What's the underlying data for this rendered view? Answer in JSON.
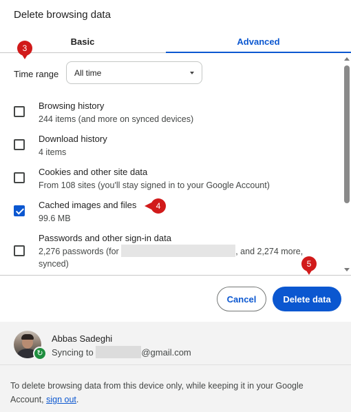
{
  "dialog": {
    "title": "Delete browsing data"
  },
  "tabs": [
    {
      "label": "Basic",
      "active": false
    },
    {
      "label": "Advanced",
      "active": true
    }
  ],
  "time_range": {
    "label": "Time range",
    "value": "All time"
  },
  "items": [
    {
      "title": "Browsing history",
      "desc": "244 items (and more on synced devices)",
      "checked": false
    },
    {
      "title": "Download history",
      "desc": "4 items",
      "checked": false
    },
    {
      "title": "Cookies and other site data",
      "desc": "From 108 sites (you'll stay signed in to your Google Account)",
      "checked": false
    },
    {
      "title": "Cached images and files",
      "desc": "99.6 MB",
      "checked": true
    },
    {
      "title": "Passwords and other sign-in data",
      "desc_prefix": "2,276 passwords (for",
      "desc_suffix": ", and 2,274 more,",
      "desc_line2": "synced)",
      "checked": false
    }
  ],
  "buttons": {
    "cancel": "Cancel",
    "delete": "Delete data"
  },
  "account": {
    "name": "Abbas Sadeghi",
    "sync_prefix": "Syncing to",
    "email_suffix": "@gmail.com"
  },
  "footer": {
    "note": "To delete browsing data from this device only, while keeping it in your Google Account,",
    "link": "sign out",
    "end": "."
  },
  "markers": {
    "m3": "3",
    "m4": "4",
    "m5": "5"
  },
  "colors": {
    "accent": "#0b57d0",
    "marker": "#d11a1a",
    "sync_badge": "#1e8e3e"
  }
}
